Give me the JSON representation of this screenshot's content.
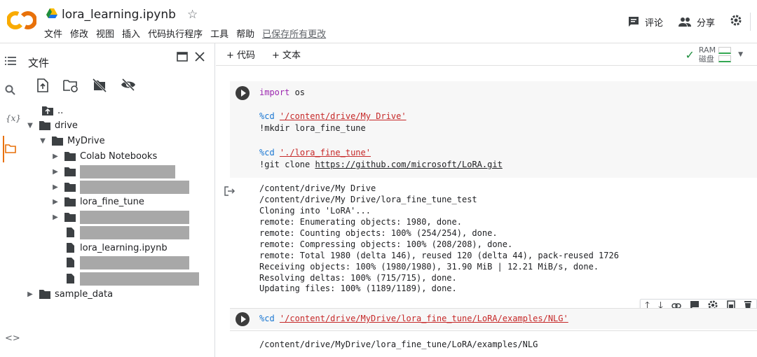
{
  "header": {
    "logo_text": "CO",
    "title": "lora_learning.ipynb",
    "menu": [
      "文件",
      "修改",
      "视图",
      "插入",
      "代码执行程序",
      "工具",
      "帮助"
    ],
    "saved_status": "已保存所有更改",
    "comment_label": "评论",
    "share_label": "分享"
  },
  "panel": {
    "title": "文件",
    "tree": {
      "parent": "..",
      "drive": "drive",
      "mydrive": "MyDrive",
      "colab": "Colab Notebooks",
      "lora_fine_tune": "lora_fine_tune",
      "notebook": "lora_learning.ipynb",
      "sample_data": "sample_data"
    }
  },
  "toolbar": {
    "add_code": "+ 代码",
    "add_text": "+ 文本",
    "ram_label": "RAM",
    "disk_label": "磁盘"
  },
  "cell1": {
    "import_kw": "import",
    "import_mod": " os",
    "cd1_cmd": "%cd",
    "cd1_arg": "'/content/drive/My Drive'",
    "mkdir": "!mkdir lora_fine_tune",
    "cd2_cmd": "%cd",
    "cd2_arg": "'./lora_fine_tune'",
    "git_prefix": "!git clone ",
    "git_url": "https://github.com/microsoft/LoRA.git"
  },
  "output1": [
    "/content/drive/My Drive",
    "/content/drive/My Drive/lora_fine_tune_test",
    "Cloning into 'LoRA'...",
    "remote: Enumerating objects: 1980, done.",
    "remote: Counting objects: 100% (254/254), done.",
    "remote: Compressing objects: 100% (208/208), done.",
    "remote: Total 1980 (delta 146), reused 120 (delta 44), pack-reused 1726",
    "Receiving objects: 100% (1980/1980), 31.90 MiB | 12.21 MiB/s, done.",
    "Resolving deltas: 100% (715/715), done.",
    "Updating files: 100% (1189/1189), done."
  ],
  "cell2": {
    "cmd": "%cd",
    "arg": "'/content/drive/MyDrive/lora_fine_tune/LoRA/examples/NLG'"
  },
  "output2": "/content/drive/MyDrive/lora_fine_tune/LoRA/examples/NLG"
}
